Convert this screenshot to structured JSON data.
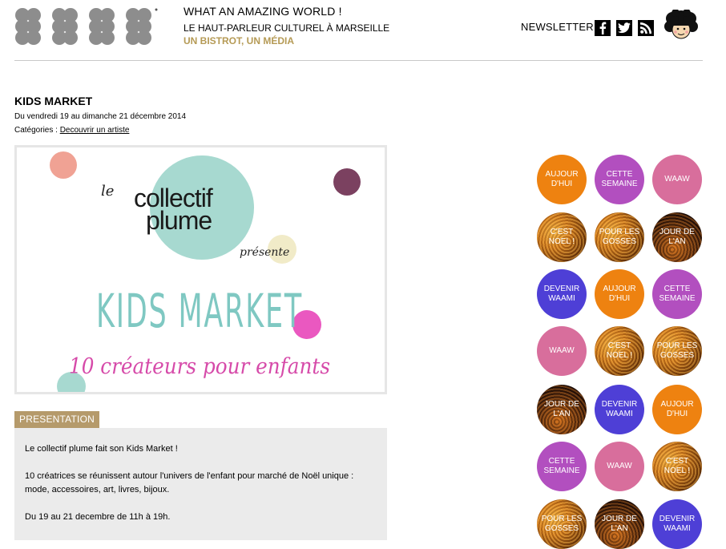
{
  "header": {
    "tagline_title": "WHAT AN AMAZING WORLD !",
    "tagline_sub": "LE HAUT-PARLEUR CULTUREL À MARSEILLE",
    "tagline_accent": "UN BISTROT, UN MÉDIA",
    "newsletter_label": "NEWSLETTER",
    "social": [
      "facebook-icon",
      "twitter-icon",
      "rss-icon"
    ],
    "accent_color": "#b59a55"
  },
  "article": {
    "title": "KIDS MARKET",
    "dates": "Du vendredi 19 au dimanche 21 décembre 2014",
    "categories_label": "Catégories : ",
    "category_link": "Decouvrir un artiste",
    "poster": {
      "le": "le",
      "brand_line1": "collectif",
      "brand_line2": "plume",
      "presente": "présente",
      "event": "KIDS MARKET",
      "subtitle": "10 créateurs pour enfants"
    },
    "presentation_tab": "PRESENTATION",
    "paragraphs": [
      "Le collectif plume fait son Kids Market !",
      "10 créatrices se réunissent autour l'univers de l'enfant pour marché de Noël unique : mode, accessoires, art, livres, bijoux.",
      "Du 19 au 21 decembre de 11h à 19h."
    ]
  },
  "grid": {
    "colors": {
      "orange": "#ee8210",
      "violet": "#b24fbf",
      "pink": "#d86e9c",
      "blue": "#4e3fd6"
    },
    "circles": [
      "AUJOUR D'HUI",
      "CETTE SEMAINE",
      "WAAW",
      "C'EST NOEL !",
      "POUR LES GOSSES",
      "JOUR DE L'AN",
      "DEVENIR WAAMI",
      "AUJOUR D'HUI",
      "CETTE SEMAINE",
      "WAAW",
      "C'EST NOEL !",
      "POUR LES GOSSES",
      "JOUR DE L'AN",
      "DEVENIR WAAMI",
      "AUJOUR D'HUI",
      "CETTE SEMAINE",
      "WAAW",
      "C'EST NOEL !",
      "POUR LES GOSSES",
      "JOUR DE L'AN",
      "DEVENIR WAAMI"
    ]
  }
}
